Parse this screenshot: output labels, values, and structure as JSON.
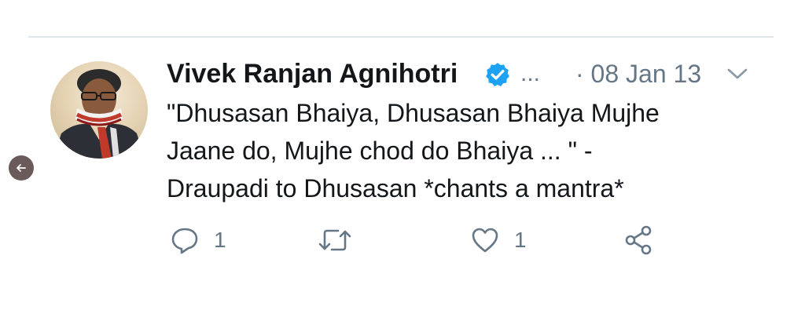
{
  "tweet": {
    "author": "Vivek Ranjan Agnihotri",
    "truncation": "...",
    "date": "· 08 Jan 13",
    "text_lines": [
      "\"Dhusasan Bhaiya, Dhusasan Bhaiya Mujhe",
      "Jaane do, Mujhe chod do Bhaiya ... \" -",
      "Draupadi to Dhusasan *chants a mantra*"
    ],
    "reply_count": "1",
    "like_count": "1"
  },
  "icons": {
    "verified": "verified-badge-icon",
    "menu": "chevron-down-icon",
    "reply": "reply-icon",
    "retweet": "retweet-icon",
    "like": "heart-icon",
    "share": "share-icon",
    "back": "arrow-left-icon"
  },
  "colors": {
    "text": "#14171a",
    "muted": "#657786",
    "verified": "#1da1f2",
    "divider": "#e1e6ea",
    "back_button": "#6a5a5a"
  }
}
